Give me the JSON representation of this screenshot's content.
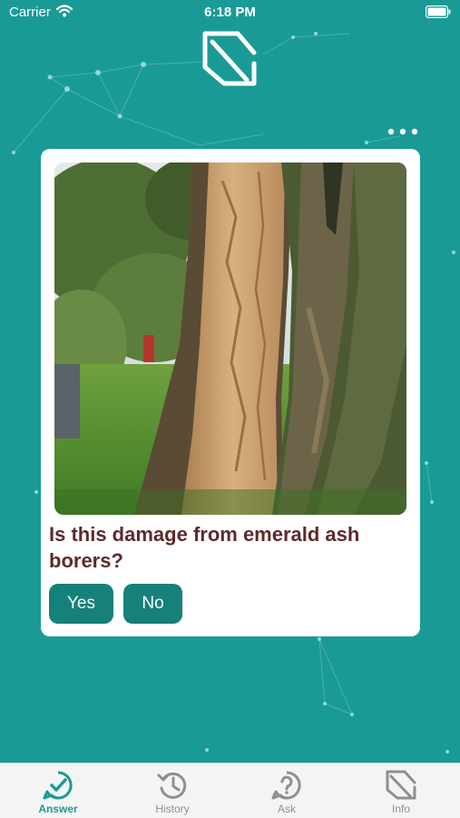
{
  "status_bar": {
    "carrier": "Carrier",
    "time": "6:18 PM"
  },
  "card": {
    "question": "Is this damage from emerald ash borers?",
    "yes_label": "Yes",
    "no_label": "No"
  },
  "tabbar": {
    "items": [
      {
        "label": "Answer",
        "icon": "answer-check-icon",
        "active": true
      },
      {
        "label": "History",
        "icon": "history-icon",
        "active": false
      },
      {
        "label": "Ask",
        "icon": "ask-question-icon",
        "active": false
      },
      {
        "label": "Info",
        "icon": "info-logo-icon",
        "active": false
      }
    ]
  },
  "colors": {
    "background": "#1a9a96",
    "button": "#16807b",
    "question_text": "#5e2a2a",
    "tab_active": "#1a9a96",
    "tab_inactive": "#8e8e93"
  }
}
